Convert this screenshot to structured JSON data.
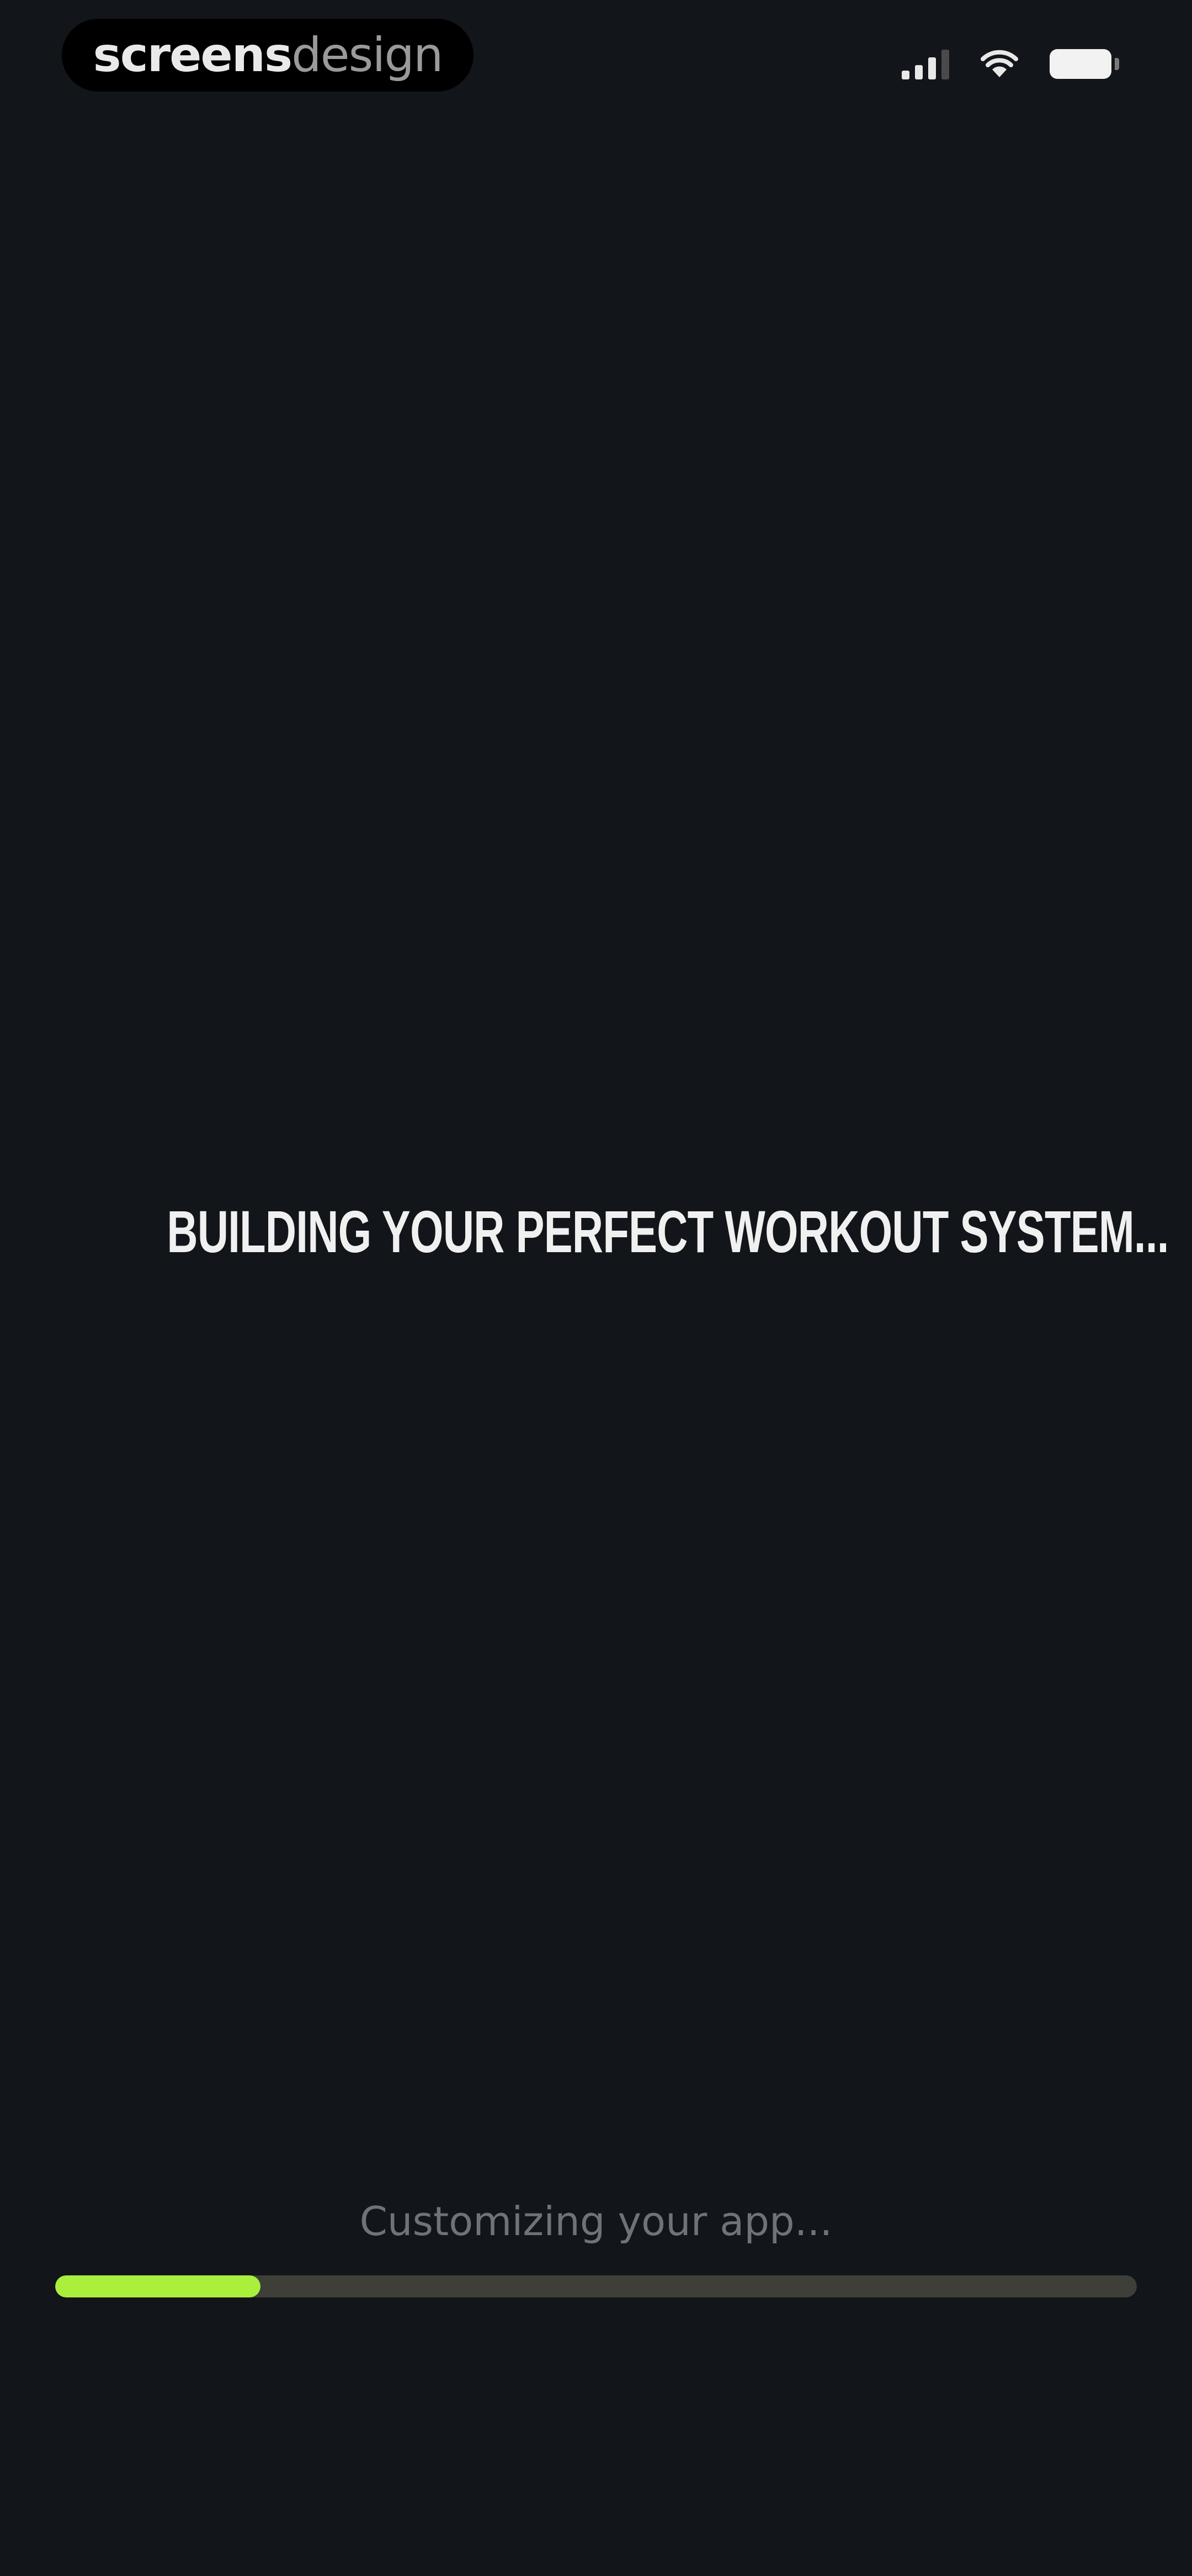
{
  "header": {
    "brand_strong": "screens",
    "brand_light": "design"
  },
  "status_bar": {
    "icons": [
      "signal-icon",
      "wifi-icon",
      "battery-icon"
    ]
  },
  "main": {
    "headline": "BUILDING YOUR PERFECT WORKOUT SYSTEM..."
  },
  "progress": {
    "label": "Customizing your app...",
    "fraction": 0.19
  },
  "colors": {
    "background": "#121519",
    "accent": "#a9ef3c",
    "track": "#3d3f38"
  }
}
